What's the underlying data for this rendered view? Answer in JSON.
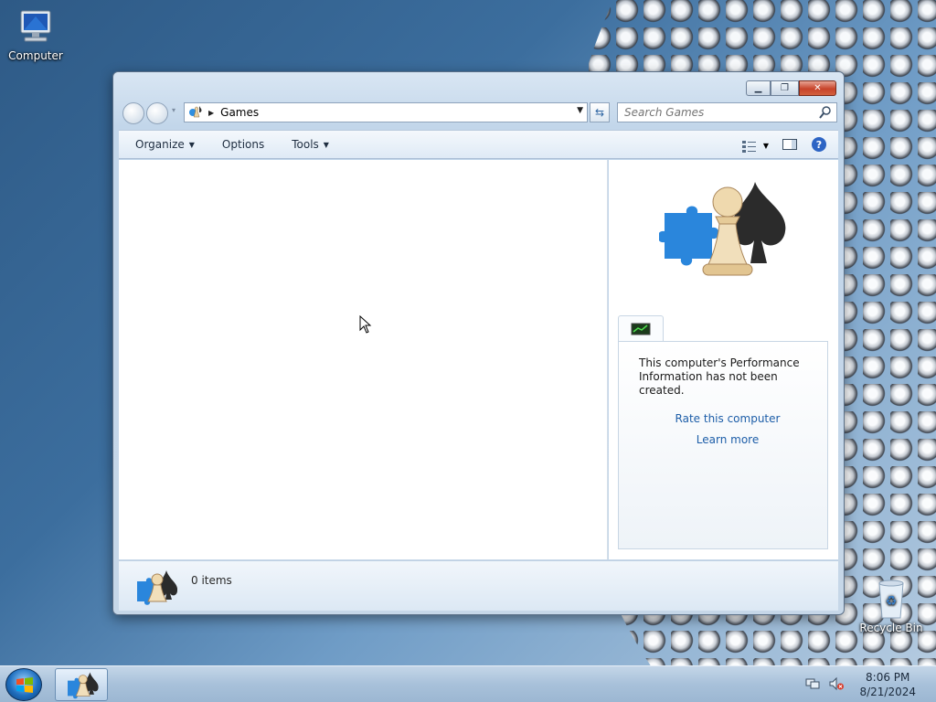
{
  "desktop": {
    "icons": [
      {
        "label": "Computer",
        "icon": "computer-icon"
      },
      {
        "label": "Recycle Bin",
        "icon": "recycle-bin-icon"
      }
    ]
  },
  "window": {
    "address": {
      "crumb": "Games"
    },
    "search": {
      "placeholder": "Search Games"
    },
    "toolbar": {
      "organize": "Organize",
      "options": "Options",
      "tools": "Tools"
    },
    "preview": {
      "performance_text": "This computer's Performance Information has not been created.",
      "rate_link": "Rate this computer",
      "learn_link": "Learn more"
    },
    "details": {
      "count": "0 items"
    }
  },
  "taskbar": {
    "clock_time": "8:06 PM",
    "clock_date": "8/21/2024"
  },
  "colors": {
    "link": "#1d5ea8",
    "close_button": "#c7432a",
    "taskbar": "#a8c1da"
  }
}
